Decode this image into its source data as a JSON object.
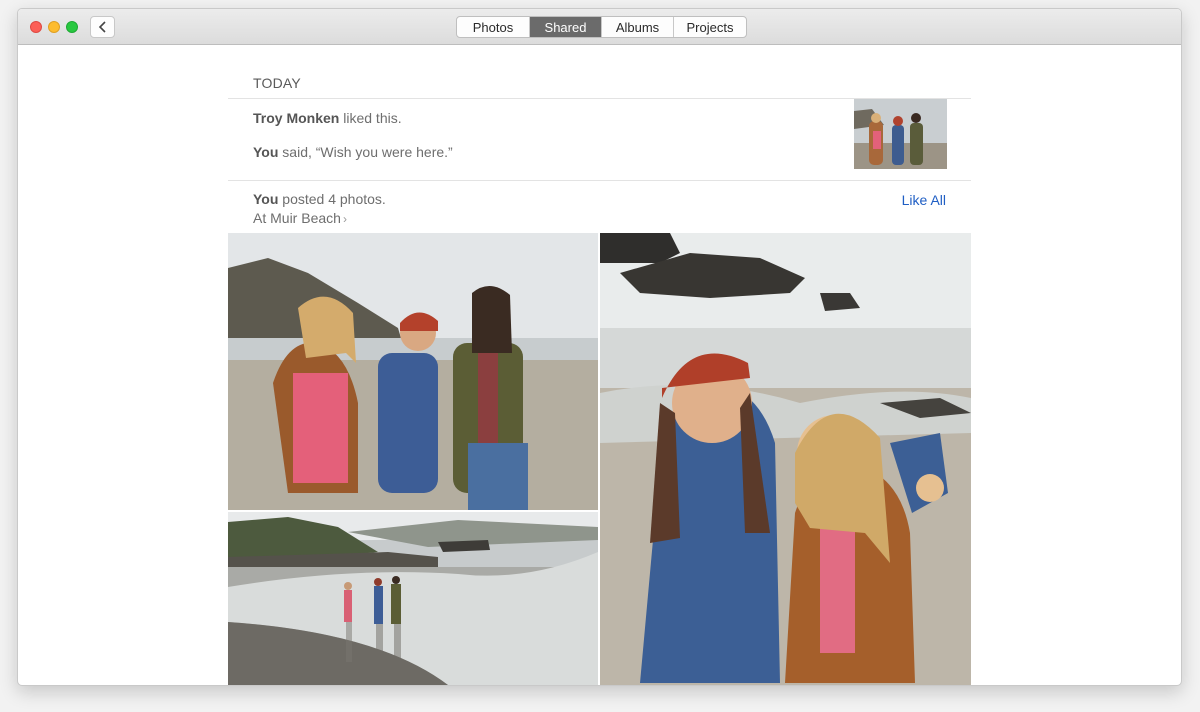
{
  "window": {
    "tabs": [
      {
        "label": "Photos",
        "active": false
      },
      {
        "label": "Shared",
        "active": true
      },
      {
        "label": "Albums",
        "active": false
      },
      {
        "label": "Projects",
        "active": false
      }
    ]
  },
  "feed": {
    "section_title": "TODAY",
    "activity": {
      "like_name": "Troy Monken",
      "like_text": " liked this.",
      "comment_name": "You",
      "comment_text": " said, “Wish you were here.”"
    },
    "post": {
      "author": "You",
      "text": " posted 4 photos.",
      "location": "At Muir Beach",
      "location_chevron": "›",
      "like_all": "Like All"
    }
  },
  "colors": {
    "accent_link": "#1f5ec4",
    "active_tab": "#6b6b6b"
  },
  "icons": {
    "back": "chevron-left-icon",
    "location": "chevron-right-icon"
  }
}
